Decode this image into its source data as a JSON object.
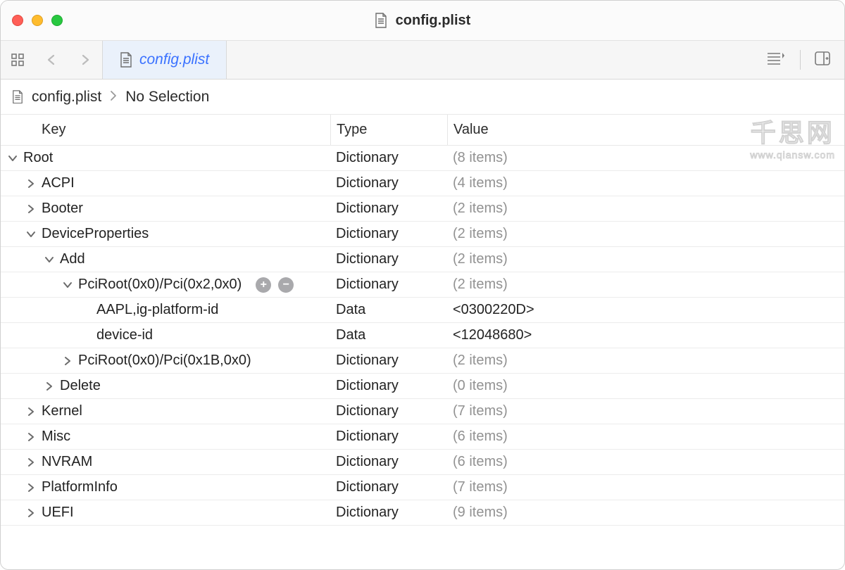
{
  "window": {
    "title": "config.plist"
  },
  "toolbar": {
    "tab_label": "config.plist"
  },
  "breadcrumb": {
    "file": "config.plist",
    "selection": "No Selection"
  },
  "columns": {
    "key": "Key",
    "type": "Type",
    "value": "Value"
  },
  "rows": [
    {
      "key": "Root",
      "type": "Dictionary",
      "value": "(8 items)",
      "level": 0,
      "arrow": "down",
      "dim": true
    },
    {
      "key": "ACPI",
      "type": "Dictionary",
      "value": "(4 items)",
      "level": 1,
      "arrow": "right",
      "dim": true
    },
    {
      "key": "Booter",
      "type": "Dictionary",
      "value": "(2 items)",
      "level": 1,
      "arrow": "right",
      "dim": true
    },
    {
      "key": "DeviceProperties",
      "type": "Dictionary",
      "value": "(2 items)",
      "level": 1,
      "arrow": "down",
      "dim": true
    },
    {
      "key": "Add",
      "type": "Dictionary",
      "value": "(2 items)",
      "level": 2,
      "arrow": "down",
      "dim": true
    },
    {
      "key": "PciRoot(0x0)/Pci(0x2,0x0)",
      "type": "Dictionary",
      "value": "(2 items)",
      "level": 3,
      "arrow": "down",
      "dim": true,
      "hasButtons": true
    },
    {
      "key": "AAPL,ig-platform-id",
      "type": "Data",
      "value": "<0300220D>",
      "level": 4,
      "arrow": "none",
      "dim": false
    },
    {
      "key": "device-id",
      "type": "Data",
      "value": "<12048680>",
      "level": 4,
      "arrow": "none",
      "dim": false
    },
    {
      "key": "PciRoot(0x0)/Pci(0x1B,0x0)",
      "type": "Dictionary",
      "value": "(2 items)",
      "level": 3,
      "arrow": "right",
      "dim": true
    },
    {
      "key": "Delete",
      "type": "Dictionary",
      "value": "(0 items)",
      "level": 2,
      "arrow": "right",
      "dim": true
    },
    {
      "key": "Kernel",
      "type": "Dictionary",
      "value": "(7 items)",
      "level": 1,
      "arrow": "right",
      "dim": true
    },
    {
      "key": "Misc",
      "type": "Dictionary",
      "value": "(6 items)",
      "level": 1,
      "arrow": "right",
      "dim": true
    },
    {
      "key": "NVRAM",
      "type": "Dictionary",
      "value": "(6 items)",
      "level": 1,
      "arrow": "right",
      "dim": true
    },
    {
      "key": "PlatformInfo",
      "type": "Dictionary",
      "value": "(7 items)",
      "level": 1,
      "arrow": "right",
      "dim": true
    },
    {
      "key": "UEFI",
      "type": "Dictionary",
      "value": "(9 items)",
      "level": 1,
      "arrow": "right",
      "dim": true
    }
  ],
  "watermark": {
    "big": "千思网",
    "small": "www.qiansw.com"
  }
}
